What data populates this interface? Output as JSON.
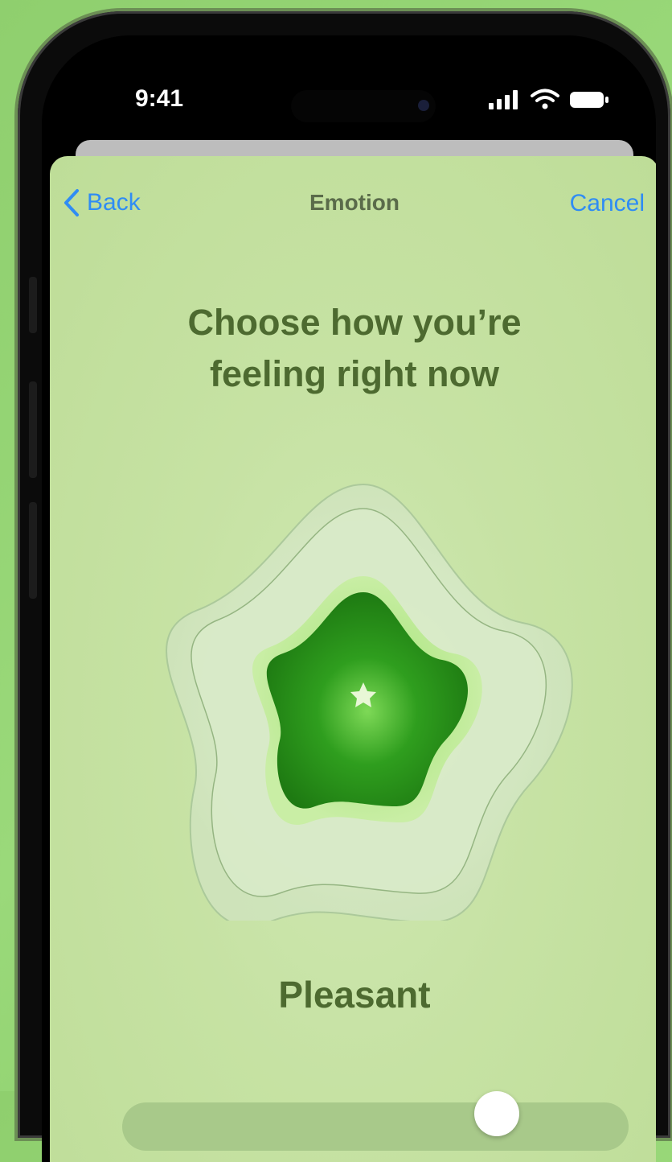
{
  "status_bar": {
    "time": "9:41",
    "icons": [
      "signal-icon",
      "wifi-icon",
      "battery-icon"
    ]
  },
  "nav": {
    "back_label": "Back",
    "title": "Emotion",
    "cancel_label": "Cancel"
  },
  "prompt": {
    "line1": "Choose how you’re",
    "line2": "feeling right now"
  },
  "emotion": {
    "label": "Pleasant",
    "icon": "star-icon",
    "color": "#2f9e1e"
  },
  "slider": {
    "value": 0.74
  },
  "colors": {
    "accent": "#2f8cf4",
    "heading": "#4d6a30",
    "background": "#c6e2a3"
  }
}
